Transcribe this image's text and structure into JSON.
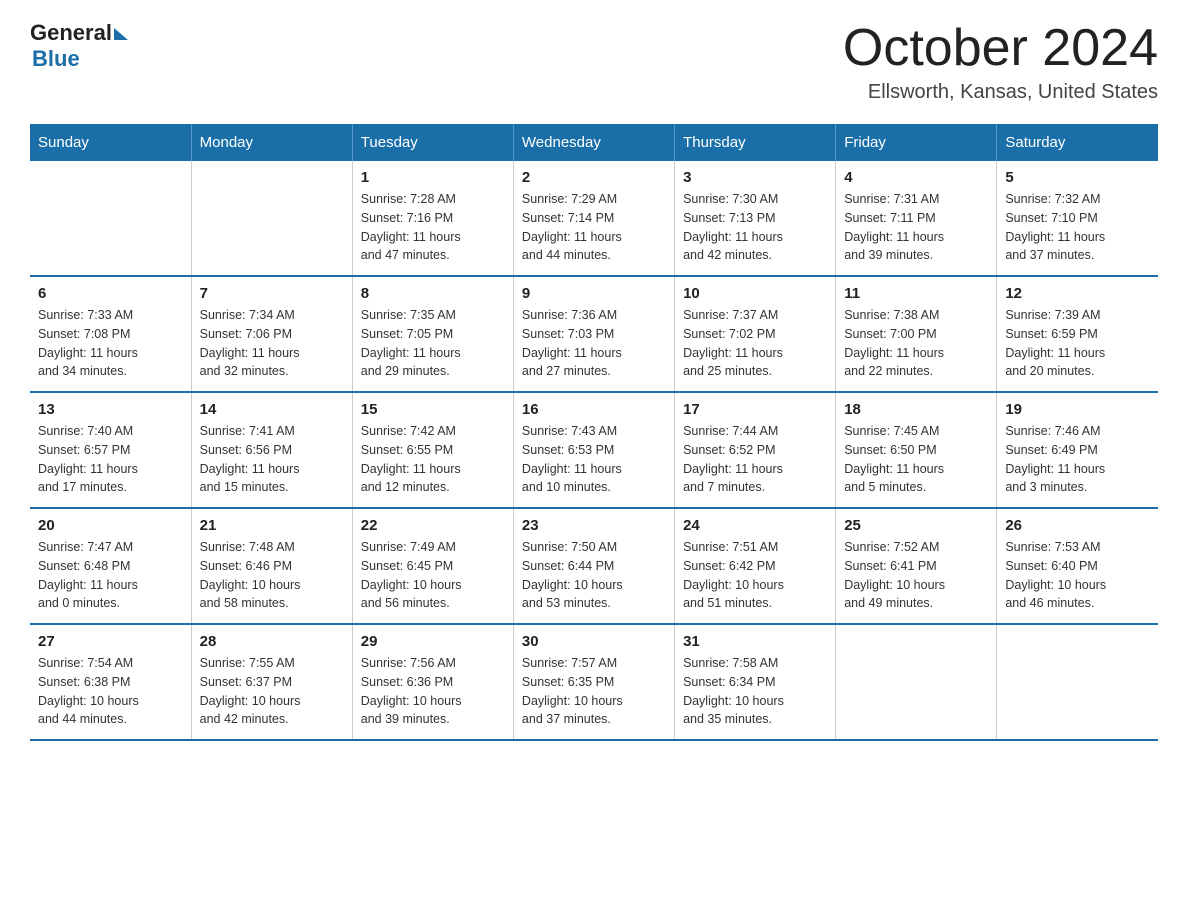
{
  "header": {
    "logo_general": "General",
    "logo_blue": "Blue",
    "month_title": "October 2024",
    "location": "Ellsworth, Kansas, United States"
  },
  "days_of_week": [
    "Sunday",
    "Monday",
    "Tuesday",
    "Wednesday",
    "Thursday",
    "Friday",
    "Saturday"
  ],
  "weeks": [
    [
      {
        "day": "",
        "info": ""
      },
      {
        "day": "",
        "info": ""
      },
      {
        "day": "1",
        "info": "Sunrise: 7:28 AM\nSunset: 7:16 PM\nDaylight: 11 hours\nand 47 minutes."
      },
      {
        "day": "2",
        "info": "Sunrise: 7:29 AM\nSunset: 7:14 PM\nDaylight: 11 hours\nand 44 minutes."
      },
      {
        "day": "3",
        "info": "Sunrise: 7:30 AM\nSunset: 7:13 PM\nDaylight: 11 hours\nand 42 minutes."
      },
      {
        "day": "4",
        "info": "Sunrise: 7:31 AM\nSunset: 7:11 PM\nDaylight: 11 hours\nand 39 minutes."
      },
      {
        "day": "5",
        "info": "Sunrise: 7:32 AM\nSunset: 7:10 PM\nDaylight: 11 hours\nand 37 minutes."
      }
    ],
    [
      {
        "day": "6",
        "info": "Sunrise: 7:33 AM\nSunset: 7:08 PM\nDaylight: 11 hours\nand 34 minutes."
      },
      {
        "day": "7",
        "info": "Sunrise: 7:34 AM\nSunset: 7:06 PM\nDaylight: 11 hours\nand 32 minutes."
      },
      {
        "day": "8",
        "info": "Sunrise: 7:35 AM\nSunset: 7:05 PM\nDaylight: 11 hours\nand 29 minutes."
      },
      {
        "day": "9",
        "info": "Sunrise: 7:36 AM\nSunset: 7:03 PM\nDaylight: 11 hours\nand 27 minutes."
      },
      {
        "day": "10",
        "info": "Sunrise: 7:37 AM\nSunset: 7:02 PM\nDaylight: 11 hours\nand 25 minutes."
      },
      {
        "day": "11",
        "info": "Sunrise: 7:38 AM\nSunset: 7:00 PM\nDaylight: 11 hours\nand 22 minutes."
      },
      {
        "day": "12",
        "info": "Sunrise: 7:39 AM\nSunset: 6:59 PM\nDaylight: 11 hours\nand 20 minutes."
      }
    ],
    [
      {
        "day": "13",
        "info": "Sunrise: 7:40 AM\nSunset: 6:57 PM\nDaylight: 11 hours\nand 17 minutes."
      },
      {
        "day": "14",
        "info": "Sunrise: 7:41 AM\nSunset: 6:56 PM\nDaylight: 11 hours\nand 15 minutes."
      },
      {
        "day": "15",
        "info": "Sunrise: 7:42 AM\nSunset: 6:55 PM\nDaylight: 11 hours\nand 12 minutes."
      },
      {
        "day": "16",
        "info": "Sunrise: 7:43 AM\nSunset: 6:53 PM\nDaylight: 11 hours\nand 10 minutes."
      },
      {
        "day": "17",
        "info": "Sunrise: 7:44 AM\nSunset: 6:52 PM\nDaylight: 11 hours\nand 7 minutes."
      },
      {
        "day": "18",
        "info": "Sunrise: 7:45 AM\nSunset: 6:50 PM\nDaylight: 11 hours\nand 5 minutes."
      },
      {
        "day": "19",
        "info": "Sunrise: 7:46 AM\nSunset: 6:49 PM\nDaylight: 11 hours\nand 3 minutes."
      }
    ],
    [
      {
        "day": "20",
        "info": "Sunrise: 7:47 AM\nSunset: 6:48 PM\nDaylight: 11 hours\nand 0 minutes."
      },
      {
        "day": "21",
        "info": "Sunrise: 7:48 AM\nSunset: 6:46 PM\nDaylight: 10 hours\nand 58 minutes."
      },
      {
        "day": "22",
        "info": "Sunrise: 7:49 AM\nSunset: 6:45 PM\nDaylight: 10 hours\nand 56 minutes."
      },
      {
        "day": "23",
        "info": "Sunrise: 7:50 AM\nSunset: 6:44 PM\nDaylight: 10 hours\nand 53 minutes."
      },
      {
        "day": "24",
        "info": "Sunrise: 7:51 AM\nSunset: 6:42 PM\nDaylight: 10 hours\nand 51 minutes."
      },
      {
        "day": "25",
        "info": "Sunrise: 7:52 AM\nSunset: 6:41 PM\nDaylight: 10 hours\nand 49 minutes."
      },
      {
        "day": "26",
        "info": "Sunrise: 7:53 AM\nSunset: 6:40 PM\nDaylight: 10 hours\nand 46 minutes."
      }
    ],
    [
      {
        "day": "27",
        "info": "Sunrise: 7:54 AM\nSunset: 6:38 PM\nDaylight: 10 hours\nand 44 minutes."
      },
      {
        "day": "28",
        "info": "Sunrise: 7:55 AM\nSunset: 6:37 PM\nDaylight: 10 hours\nand 42 minutes."
      },
      {
        "day": "29",
        "info": "Sunrise: 7:56 AM\nSunset: 6:36 PM\nDaylight: 10 hours\nand 39 minutes."
      },
      {
        "day": "30",
        "info": "Sunrise: 7:57 AM\nSunset: 6:35 PM\nDaylight: 10 hours\nand 37 minutes."
      },
      {
        "day": "31",
        "info": "Sunrise: 7:58 AM\nSunset: 6:34 PM\nDaylight: 10 hours\nand 35 minutes."
      },
      {
        "day": "",
        "info": ""
      },
      {
        "day": "",
        "info": ""
      }
    ]
  ]
}
